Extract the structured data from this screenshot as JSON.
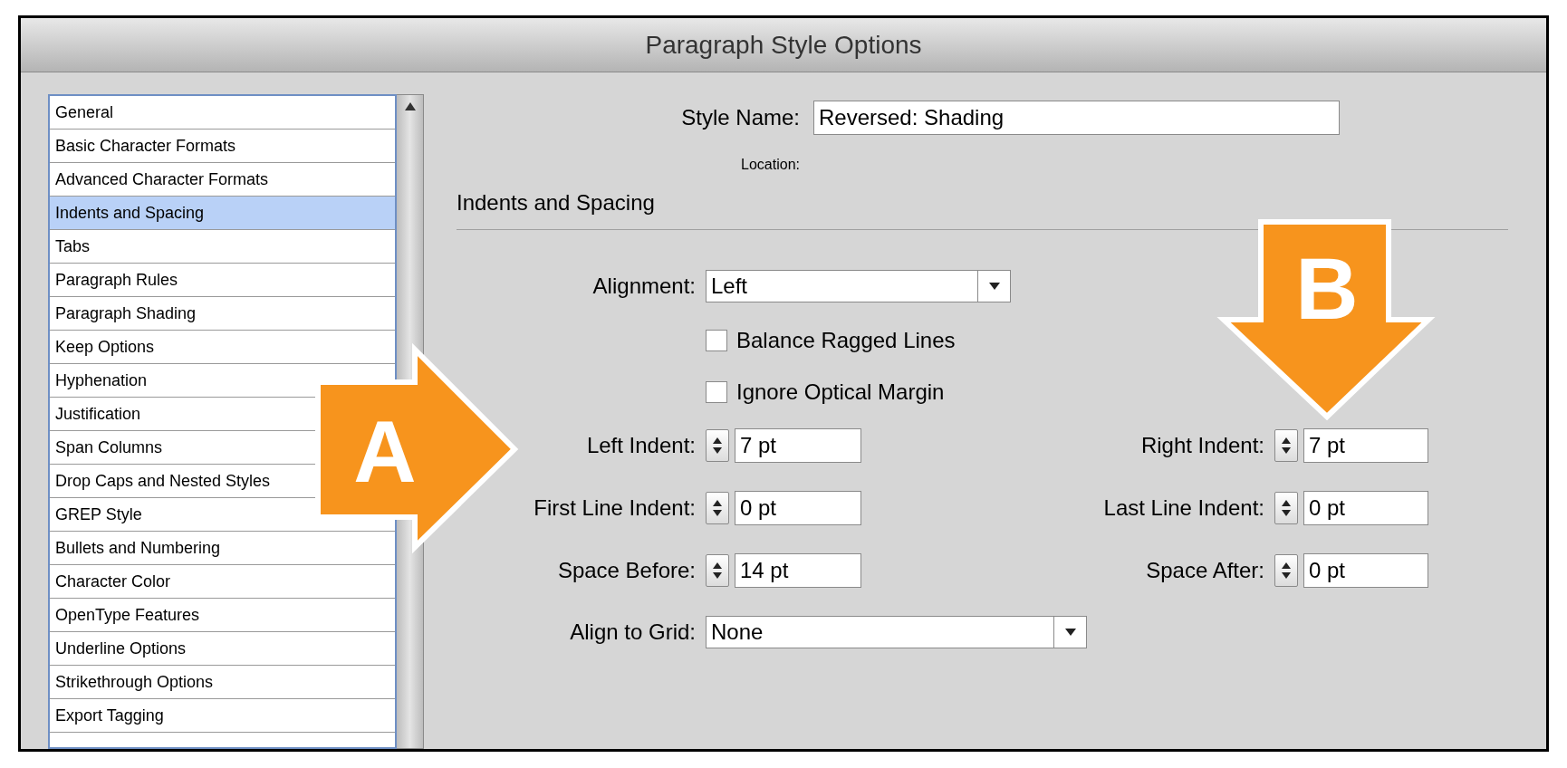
{
  "window": {
    "title": "Paragraph Style Options"
  },
  "sidebar": {
    "items": [
      {
        "label": "General",
        "selected": false
      },
      {
        "label": "Basic Character Formats",
        "selected": false
      },
      {
        "label": "Advanced Character Formats",
        "selected": false
      },
      {
        "label": "Indents and Spacing",
        "selected": true
      },
      {
        "label": "Tabs",
        "selected": false
      },
      {
        "label": "Paragraph Rules",
        "selected": false
      },
      {
        "label": "Paragraph Shading",
        "selected": false
      },
      {
        "label": "Keep Options",
        "selected": false
      },
      {
        "label": "Hyphenation",
        "selected": false
      },
      {
        "label": "Justification",
        "selected": false
      },
      {
        "label": "Span Columns",
        "selected": false
      },
      {
        "label": "Drop Caps and Nested Styles",
        "selected": false
      },
      {
        "label": "GREP Style",
        "selected": false
      },
      {
        "label": "Bullets and Numbering",
        "selected": false
      },
      {
        "label": "Character Color",
        "selected": false
      },
      {
        "label": "OpenType Features",
        "selected": false
      },
      {
        "label": "Underline Options",
        "selected": false
      },
      {
        "label": "Strikethrough Options",
        "selected": false
      },
      {
        "label": "Export Tagging",
        "selected": false
      }
    ]
  },
  "style_name": {
    "label": "Style Name:",
    "value": "Reversed: Shading"
  },
  "location": {
    "label": "Location:"
  },
  "section": {
    "title": "Indents and Spacing"
  },
  "alignment": {
    "label": "Alignment:",
    "value": "Left"
  },
  "checkboxes": [
    {
      "label": "Balance Ragged Lines",
      "checked": false
    },
    {
      "label": "Ignore Optical Margin",
      "checked": false
    }
  ],
  "spinner_rows": [
    {
      "left": {
        "label": "Left Indent:",
        "value": "7 pt"
      },
      "right": {
        "label": "Right Indent:",
        "value": "7 pt"
      }
    },
    {
      "left": {
        "label": "First Line Indent:",
        "value": "0 pt"
      },
      "right": {
        "label": "Last Line Indent:",
        "value": "0 pt"
      }
    },
    {
      "left": {
        "label": "Space Before:",
        "value": "14 pt"
      },
      "right": {
        "label": "Space After:",
        "value": "0 pt"
      }
    }
  ],
  "align_to_grid": {
    "label": "Align to Grid:",
    "value": "None"
  },
  "callouts": [
    {
      "letter": "A",
      "kind": "right"
    },
    {
      "letter": "B",
      "kind": "down"
    }
  ]
}
